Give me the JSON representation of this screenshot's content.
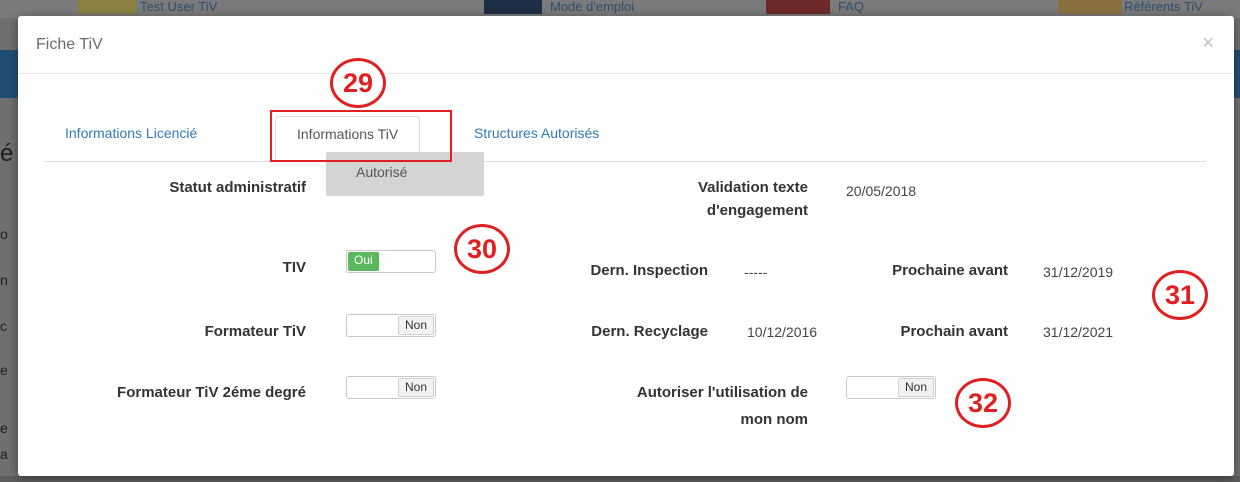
{
  "background": {
    "links": [
      "Test User TiV",
      "Mode d'emploi",
      "FAQ",
      "Référents TiV"
    ],
    "letters": [
      "é",
      "é",
      "o",
      "n",
      "c",
      "e",
      "e",
      "a"
    ]
  },
  "modal": {
    "title": "Fiche TiV",
    "close_icon": "×"
  },
  "tabs": [
    {
      "label": "Informations Licencié"
    },
    {
      "label": "Informations TiV"
    },
    {
      "label": "Structures Autorisés"
    }
  ],
  "fields": {
    "statut_label": "Statut administratif",
    "statut_value": "Autorisé",
    "validation_label_1": "Validation texte",
    "validation_label_2": "d'engagement",
    "validation_value": "20/05/2018",
    "tiv_label": "TIV",
    "tiv_toggle": "Oui",
    "dern_inspection_label": "Dern. Inspection",
    "dern_inspection_value": "-----",
    "prochaine_avant_label": "Prochaine avant",
    "prochaine_avant_value": "31/12/2019",
    "formateur_label": "Formateur TiV",
    "formateur_toggle": "Non",
    "dern_recyclage_label": "Dern. Recyclage",
    "dern_recyclage_value": "10/12/2016",
    "prochain_avant_label": "Prochain avant",
    "prochain_avant_value": "31/12/2021",
    "formateur2_label": "Formateur TiV 2éme degré",
    "formateur2_toggle": "Non",
    "autoriser_label_1": "Autoriser l'utilisation de",
    "autoriser_label_2": "mon nom",
    "autoriser_toggle": "Non"
  },
  "annotations": {
    "a29": "29",
    "a30": "30",
    "a31": "31",
    "a32": "32"
  },
  "colors": {
    "annotation": "#e02020",
    "toggle_on": "#5cb85c",
    "link": "#337ab7"
  }
}
